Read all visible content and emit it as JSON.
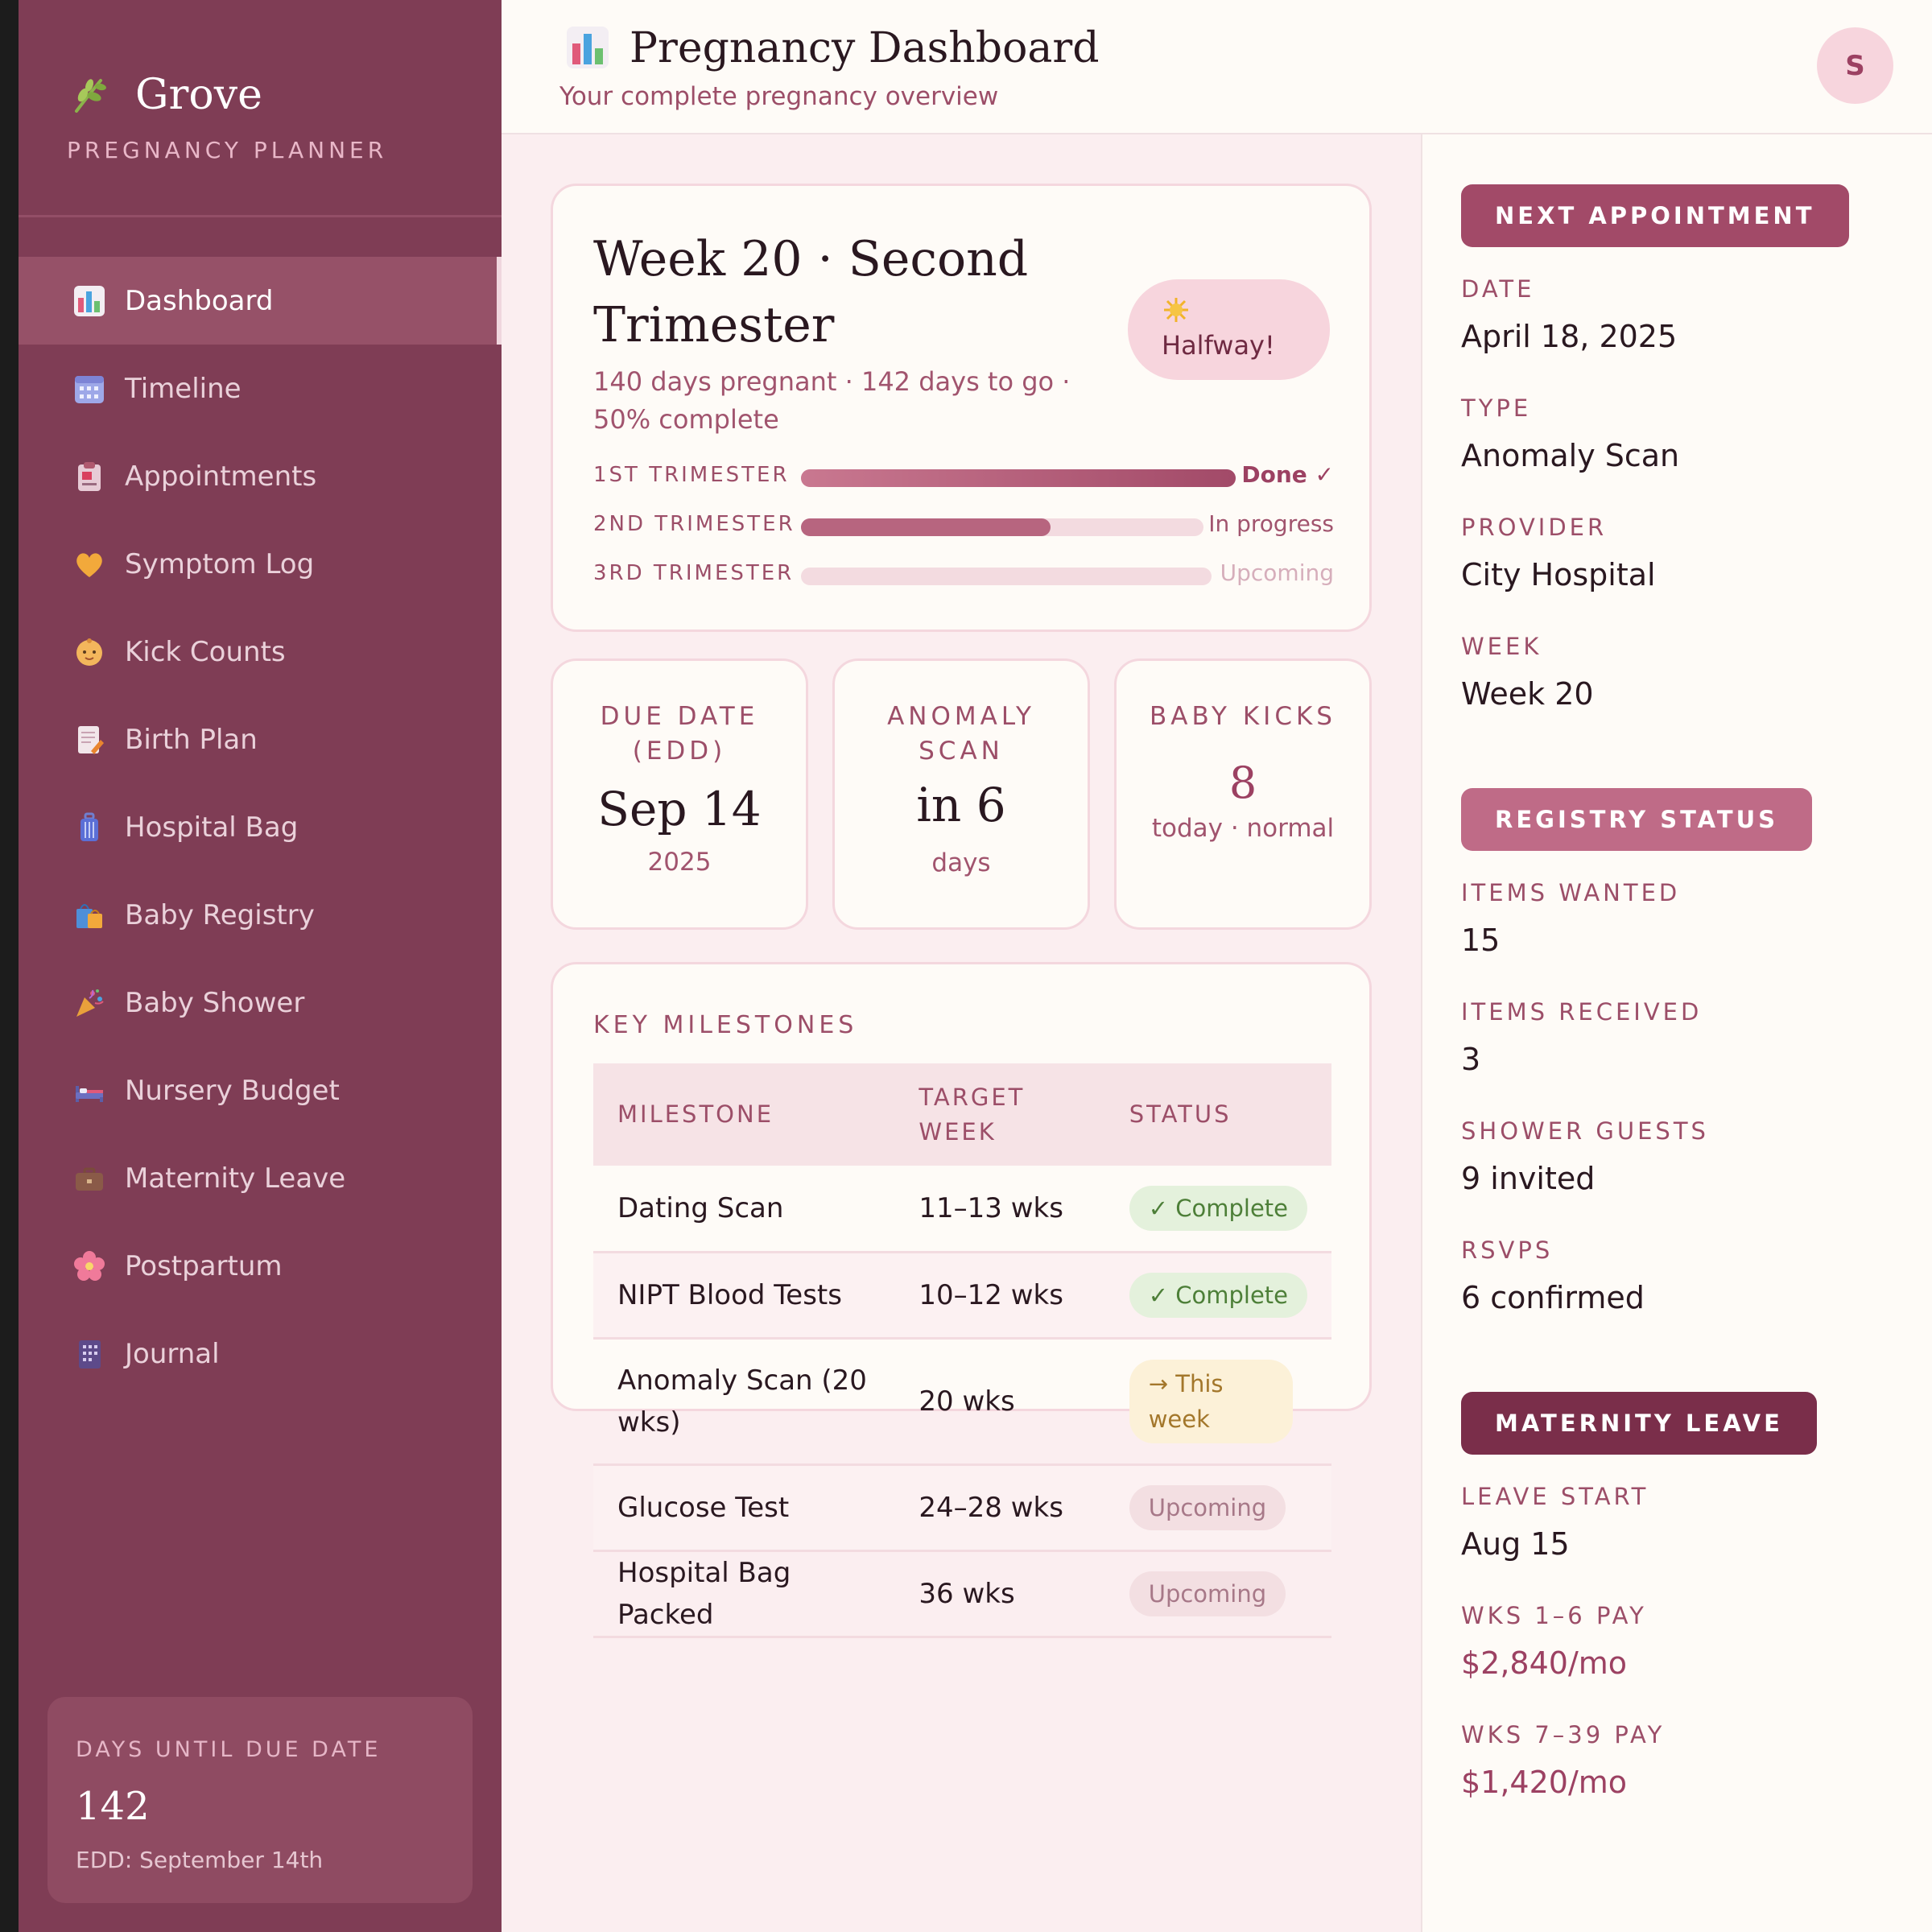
{
  "app": {
    "name": "Grove",
    "tagline": "PREGNANCY PLANNER"
  },
  "colors": {
    "sidebar": "#7f3d55",
    "accent": "#9c4162",
    "accent_dark": "#7a2e4a",
    "accent_light": "#b7657f",
    "background": "#fbeef0",
    "panel": "#fefbf7",
    "complete": "#4d7f38",
    "this_week": "#a3772b"
  },
  "nav": [
    {
      "label": "Dashboard",
      "icon": "bar-chart-icon",
      "active": true
    },
    {
      "label": "Timeline",
      "icon": "calendar-icon"
    },
    {
      "label": "Appointments",
      "icon": "clipboard-icon"
    },
    {
      "label": "Symptom Log",
      "icon": "heart-icon"
    },
    {
      "label": "Kick Counts",
      "icon": "baby-icon"
    },
    {
      "label": "Birth Plan",
      "icon": "memo-icon"
    },
    {
      "label": "Hospital Bag",
      "icon": "luggage-icon"
    },
    {
      "label": "Baby Registry",
      "icon": "shopping-bags-icon"
    },
    {
      "label": "Baby Shower",
      "icon": "party-popper-icon"
    },
    {
      "label": "Nursery Budget",
      "icon": "bed-icon"
    },
    {
      "label": "Maternity Leave",
      "icon": "briefcase-icon"
    },
    {
      "label": "Postpartum",
      "icon": "flower-icon"
    },
    {
      "label": "Journal",
      "icon": "notebook-icon"
    }
  ],
  "days_card": {
    "title": "DAYS UNTIL DUE DATE",
    "value": "142",
    "edd": "EDD: September 14th"
  },
  "header": {
    "title": "Pregnancy Dashboard",
    "subtitle": "Your complete pregnancy overview",
    "avatar": "S"
  },
  "week_card": {
    "title": "Week 20 · Second Trimester",
    "subtitle": "140 days pregnant · 142 days to go · 50% complete",
    "badge": "Halfway!",
    "trimesters": [
      {
        "label": "1ST TRIMESTER",
        "status": "Done ✓",
        "progress": 1.0,
        "state": "done"
      },
      {
        "label": "2ND TRIMESTER",
        "status": "In progress",
        "progress": 0.62,
        "state": "progress"
      },
      {
        "label": "3RD TRIMESTER",
        "status": "Upcoming",
        "progress": 0.0,
        "state": "upcoming"
      }
    ]
  },
  "stats": [
    {
      "label": "DUE DATE (EDD)",
      "value": "Sep 14",
      "sub": "2025"
    },
    {
      "label": "ANOMALY SCAN",
      "value": "in 6",
      "sub": "days"
    },
    {
      "label": "BABY KICKS",
      "value": "8",
      "sub": "today · normal"
    }
  ],
  "milestones": {
    "title": "KEY MILESTONES",
    "columns": [
      "MILESTONE",
      "TARGET WEEK",
      "STATUS"
    ],
    "rows": [
      {
        "milestone": "Dating Scan",
        "week": "11–13 wks",
        "status": "✓ Complete",
        "state": "complete"
      },
      {
        "milestone": "NIPT Blood Tests",
        "week": "10–12 wks",
        "status": "✓ Complete",
        "state": "complete"
      },
      {
        "milestone": "Anomaly Scan (20 wks)",
        "week": "20 wks",
        "status": "→ This week",
        "state": "this-week"
      },
      {
        "milestone": "Glucose Test",
        "week": "24–28 wks",
        "status": "Upcoming",
        "state": "upcoming"
      },
      {
        "milestone": "Hospital Bag Packed",
        "week": "36 wks",
        "status": "Upcoming",
        "state": "upcoming"
      }
    ]
  },
  "appointment": {
    "tag": "NEXT APPOINTMENT",
    "fields": [
      {
        "label": "DATE",
        "value": "April 18, 2025"
      },
      {
        "label": "TYPE",
        "value": "Anomaly Scan"
      },
      {
        "label": "PROVIDER",
        "value": "City Hospital"
      },
      {
        "label": "WEEK",
        "value": "Week 20"
      }
    ]
  },
  "registry": {
    "tag": "REGISTRY STATUS",
    "fields": [
      {
        "label": "ITEMS WANTED",
        "value": "15"
      },
      {
        "label": "ITEMS RECEIVED",
        "value": "3"
      },
      {
        "label": "SHOWER GUESTS",
        "value": "9 invited"
      },
      {
        "label": "RSVPS",
        "value": "6 confirmed"
      }
    ]
  },
  "leave": {
    "tag": "MATERNITY LEAVE",
    "fields": [
      {
        "label": "LEAVE START",
        "value": "Aug 15"
      },
      {
        "label": "WKS 1–6 PAY",
        "value": "$2,840/mo"
      },
      {
        "label": "WKS 7–39 PAY",
        "value": "$1,420/mo"
      }
    ]
  }
}
